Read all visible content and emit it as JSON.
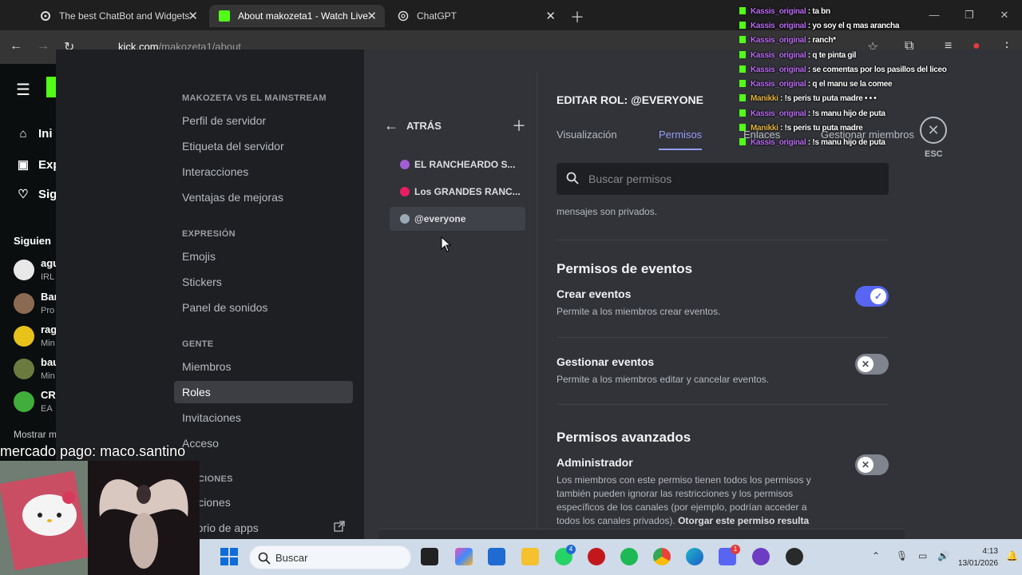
{
  "browser": {
    "tabs": [
      {
        "label": "The best ChatBot and Widgets"
      },
      {
        "label": "About makozeta1 - Watch Live"
      },
      {
        "label": "ChatGPT"
      }
    ],
    "url_host": "kick.com",
    "url_path": "/makozeta1/about"
  },
  "kick": {
    "nav": [
      {
        "label": "Ini"
      },
      {
        "label": "Exp"
      },
      {
        "label": "Sig"
      }
    ],
    "following_title": "Siguien",
    "channels": [
      {
        "name": "agu",
        "sub": "IRL"
      },
      {
        "name": "Bar",
        "sub": "Pro"
      },
      {
        "name": "rag",
        "sub": "Min"
      },
      {
        "name": "bau",
        "sub": "Min"
      },
      {
        "name": "CR",
        "sub": "EA"
      }
    ],
    "show_more": "Mostrar m"
  },
  "settings": {
    "server_header": "MAKOZETA VS EL MAINSTREAM",
    "server_items": [
      "Perfil de servidor",
      "Etiqueta del servidor",
      "Interacciones",
      "Ventajas de mejoras"
    ],
    "expression_header": "EXPRESIÓN",
    "expression_items": [
      "Emojis",
      "Stickers",
      "Panel de sonidos"
    ],
    "people_header": "GENTE",
    "people_items": [
      "Miembros",
      "Roles",
      "Invitaciones",
      "Acceso"
    ],
    "apps_header": "ICACIONES",
    "apps_items": [
      "graciones",
      "ectorio de apps"
    ]
  },
  "roles": {
    "back_label": "ATRÁS",
    "items": [
      {
        "name": "EL RANCHEARDO S...",
        "color": "#a35ed6"
      },
      {
        "name": "Los GRANDES RANC...",
        "color": "#e91e63"
      },
      {
        "name": "@everyone",
        "color": "#99aab5"
      }
    ]
  },
  "edit_role": {
    "title": "EDITAR ROL: @EVERYONE",
    "tabs": [
      "Visualización",
      "Permisos",
      "Enlaces",
      "Gestionar miembros"
    ],
    "esc_label": "ESC",
    "search_placeholder": "Buscar permisos",
    "truncated_text": "mensajes son privados.",
    "events_header": "Permisos de eventos",
    "create_events": {
      "title": "Crear eventos",
      "desc": "Permite a los miembros crear eventos.",
      "enabled": true
    },
    "manage_events": {
      "title": "Gestionar eventos",
      "desc": "Permite a los miembros editar y cancelar eventos.",
      "enabled": false
    },
    "advanced_header": "Permisos avanzados",
    "administrator": {
      "title": "Administrador",
      "desc": "Los miembros con este permiso tienen todos los permisos y también pueden ignorar las restricciones y los permisos específicos de los canales (por ejemplo, podrían acceder a todos los canales privados).",
      "desc_bold": "Otorgar este permiso resulta",
      "enabled": false
    }
  },
  "chat": [
    {
      "user": "Kassis_original",
      "msg": ": ta bn"
    },
    {
      "user": "Kassis_original",
      "msg": ": yo soy el q mas arancha"
    },
    {
      "user": "Kassis_original",
      "msg": ": ranch*"
    },
    {
      "user": "Kassis_original",
      "msg": ": q te pinta gil"
    },
    {
      "user": "Kassis_original",
      "msg": ": se comentas por los pasillos del liceo"
    },
    {
      "user": "Kassis_original",
      "msg": ": q el manu se la comee"
    },
    {
      "user": "Manikki",
      "msg": ": !s peris tu puta madre",
      "gold": true
    },
    {
      "user": "Kassis_original",
      "msg": ": !s manu hijo de puta"
    },
    {
      "user": "Manikki",
      "msg": ": !s peris tu puta madre",
      "gold": true
    },
    {
      "user": "Kassis_original",
      "msg": ": !s manu hijo de puta"
    }
  ],
  "overlay": {
    "donation_text": "mercado pago: maco.santino"
  },
  "taskbar": {
    "search_label": "Buscar",
    "time": "4:13",
    "date": "13/01/2026",
    "whatsapp_badge": "4",
    "discord_badge": "1"
  }
}
